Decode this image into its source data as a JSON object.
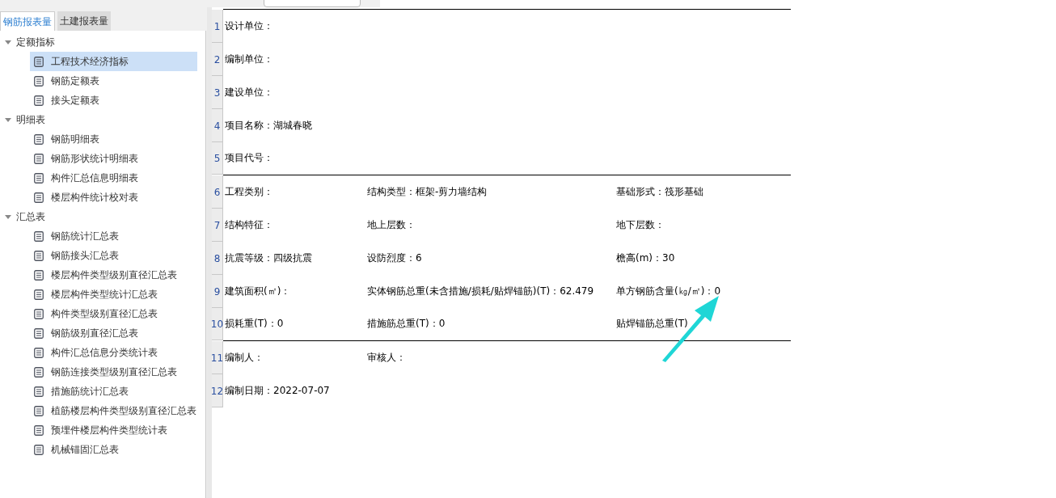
{
  "tabs": [
    {
      "label": "钢筋报表量",
      "selected": true
    },
    {
      "label": "土建报表量",
      "selected": false
    }
  ],
  "tree": [
    {
      "label": "定额指标",
      "expanded": true,
      "children": [
        {
          "label": "工程技术经济指标",
          "selected": true
        },
        {
          "label": "钢筋定额表",
          "selected": false
        },
        {
          "label": "接头定额表",
          "selected": false
        }
      ]
    },
    {
      "label": "明细表",
      "expanded": true,
      "children": [
        {
          "label": "钢筋明细表",
          "selected": false
        },
        {
          "label": "钢筋形状统计明细表",
          "selected": false
        },
        {
          "label": "构件汇总信息明细表",
          "selected": false
        },
        {
          "label": "楼层构件统计校对表",
          "selected": false
        }
      ]
    },
    {
      "label": "汇总表",
      "expanded": true,
      "children": [
        {
          "label": "钢筋统计汇总表",
          "selected": false
        },
        {
          "label": "钢筋接头汇总表",
          "selected": false
        },
        {
          "label": "楼层构件类型级别直径汇总表",
          "selected": false
        },
        {
          "label": "楼层构件类型统计汇总表",
          "selected": false
        },
        {
          "label": "构件类型级别直径汇总表",
          "selected": false
        },
        {
          "label": "钢筋级别直径汇总表",
          "selected": false
        },
        {
          "label": "构件汇总信息分类统计表",
          "selected": false
        },
        {
          "label": "钢筋连接类型级别直径汇总表",
          "selected": false
        },
        {
          "label": "措施筋统计汇总表",
          "selected": false
        },
        {
          "label": "植筋楼层构件类型级别直径汇总表",
          "selected": false
        },
        {
          "label": "预埋件楼层构件类型统计表",
          "selected": false
        },
        {
          "label": "机械锚固汇总表",
          "selected": false
        }
      ]
    }
  ],
  "report": {
    "rows": [
      {
        "number": "1",
        "cells": [
          "设计单位："
        ],
        "rule_below": false
      },
      {
        "number": "2",
        "cells": [
          "编制单位："
        ],
        "rule_below": false
      },
      {
        "number": "3",
        "cells": [
          "建设单位："
        ],
        "rule_below": false
      },
      {
        "number": "4",
        "cells": [
          "项目名称：湖城春晓"
        ],
        "rule_below": false
      },
      {
        "number": "5",
        "cells": [
          "项目代号："
        ],
        "rule_below": true
      },
      {
        "number": "6",
        "cells": [
          "工程类别：",
          "结构类型：框架-剪力墙结构",
          "基础形式：筏形基础"
        ],
        "rule_below": false
      },
      {
        "number": "7",
        "cells": [
          "结构特征：",
          "地上层数：",
          "地下层数："
        ],
        "rule_below": false
      },
      {
        "number": "8",
        "cells": [
          "抗震等级：四级抗震",
          "设防烈度：6",
          "檐高(m)：30"
        ],
        "rule_below": false
      },
      {
        "number": "9",
        "cells": [
          "建筑面积(㎡)：",
          "实体钢筋总重(未含措施/损耗/贴焊锚筋)(T)：62.479",
          "单方钢筋含量(㎏/㎡)：0"
        ],
        "rule_below": false
      },
      {
        "number": "10",
        "cells": [
          "损耗重(T)：0",
          "措施筋总重(T)：0",
          "贴焊锚筋总重(T)"
        ],
        "rule_below": true
      },
      {
        "number": "11",
        "cells": [
          "编制人：",
          "审核人："
        ],
        "rule_below": false
      },
      {
        "number": "12",
        "cells": [
          "编制日期：2022-07-07"
        ],
        "rule_below": false
      }
    ]
  }
}
